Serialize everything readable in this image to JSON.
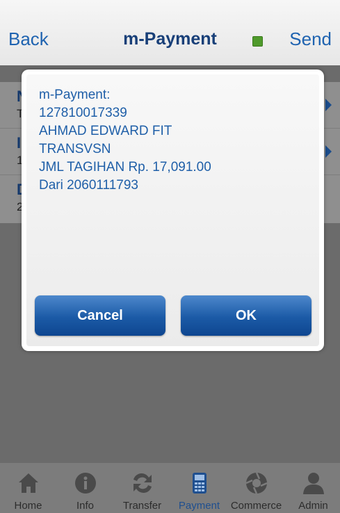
{
  "header": {
    "back_label": "Back",
    "title": "m-Payment",
    "send_label": "Send",
    "status_color": "#4f9a2b"
  },
  "background_form": {
    "rows": [
      {
        "label": "N",
        "value": "T"
      },
      {
        "label": "I",
        "value": "1"
      },
      {
        "label": "D",
        "value": "2"
      }
    ]
  },
  "dialog": {
    "lines": [
      "m-Payment:",
      "127810017339",
      "AHMAD EDWARD FIT",
      "TRANSVSN",
      "JML TAGIHAN Rp. 17,091.00",
      "Dari 2060111793"
    ],
    "cancel_label": "Cancel",
    "ok_label": "OK"
  },
  "tabbar": {
    "items": [
      {
        "label": "Home",
        "icon": "home-icon"
      },
      {
        "label": "Info",
        "icon": "info-icon"
      },
      {
        "label": "Transfer",
        "icon": "transfer-icon"
      },
      {
        "label": "Payment",
        "icon": "payment-icon",
        "active": true
      },
      {
        "label": "Commerce",
        "icon": "commerce-icon"
      },
      {
        "label": "Admin",
        "icon": "admin-icon"
      }
    ]
  }
}
